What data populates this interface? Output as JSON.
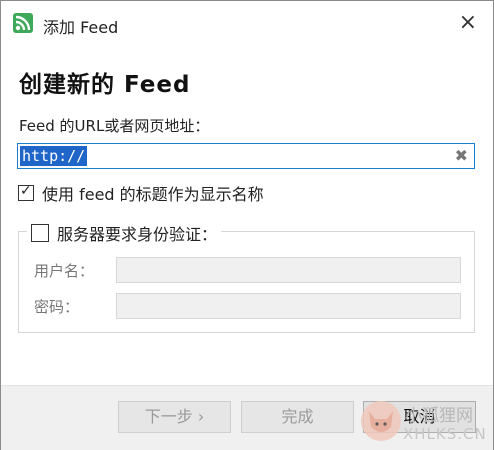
{
  "window": {
    "title": "添加 Feed",
    "icon": "rss-feed-icon",
    "close_glyph": "×"
  },
  "heading": "创建新的 Feed",
  "url": {
    "label": "Feed 的URL或者网页地址：",
    "value": "http://",
    "clear_glyph": "✖"
  },
  "use_title": {
    "checked": true,
    "label": "使用 feed 的标题作为显示名称"
  },
  "auth": {
    "checked": false,
    "label": "服务器要求身份验证：",
    "username_label": "用户名：",
    "username_value": "",
    "password_label": "密码：",
    "password_value": ""
  },
  "buttons": {
    "next": "下一步 ›",
    "finish": "完成",
    "cancel": "取消"
  },
  "watermark": {
    "line1": "小狐狸网",
    "line2": "XHLKS.CN"
  },
  "colors": {
    "accent": "#1f66c8",
    "feed_icon": "#3ea85b"
  }
}
